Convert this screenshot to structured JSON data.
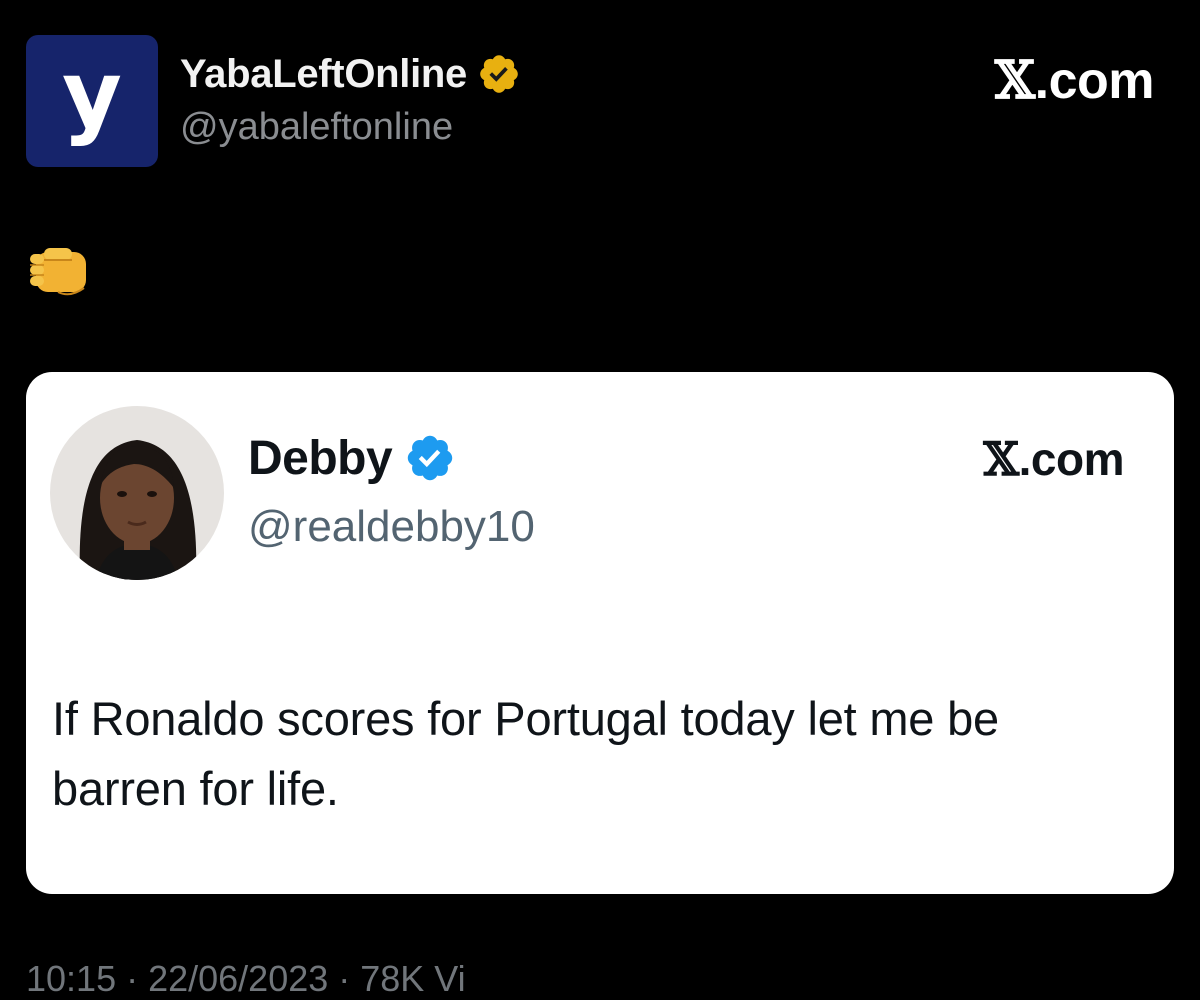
{
  "outer_tweet": {
    "avatar_letter": "y",
    "display_name": "YabaLeftOnline",
    "handle": "@yabaleftonline",
    "site_x": "𝕏",
    "site_suffix": ".com",
    "avatar_color": "#16246b",
    "badge_color": "#e8b010",
    "emoji": "oncoming-fist-icon"
  },
  "quoted_tweet": {
    "display_name": "Debby",
    "handle": "@realdebby10",
    "site_x": "𝕏",
    "site_suffix": ".com",
    "text": "If Ronaldo scores for Portugal today let me be barren for life.",
    "badge_color": "#1d9bf0"
  },
  "footer": {
    "meta": "10:15 · 22/06/2023 · 78K Vi"
  }
}
